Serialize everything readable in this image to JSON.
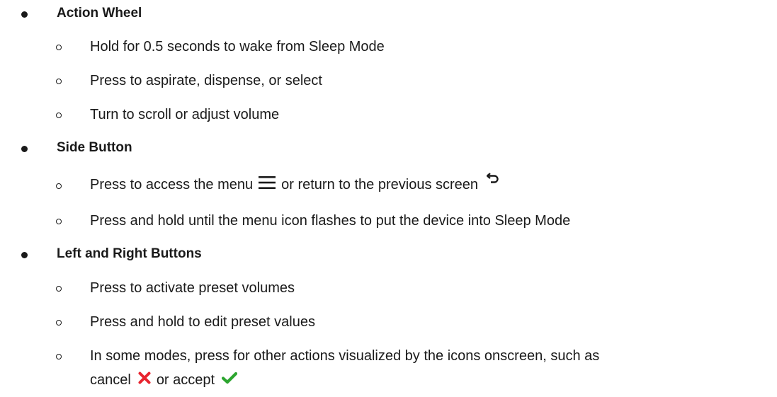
{
  "sections": [
    {
      "title": "Action Wheel",
      "items": [
        "Hold for 0.5 seconds to wake from Sleep Mode",
        "Press to aspirate, dispense, or select",
        "Turn to scroll or adjust volume"
      ]
    },
    {
      "title": "Side Button",
      "items": [
        {
          "before": "Press to access the menu",
          "icon1": "menu-icon",
          "middle": "or return to the previous screen",
          "icon2": "return-arrow-icon"
        },
        "Press and hold until the menu icon flashes to put the device into Sleep Mode"
      ]
    },
    {
      "title": "Left and Right Buttons",
      "items": [
        "Press to activate preset volumes",
        "Press and hold to edit preset values",
        {
          "line1": "In some modes, press for other actions visualized by the icons onscreen, such as",
          "line2_a": "cancel",
          "icon_cancel": "red-x-icon",
          "line2_b": "or accept",
          "icon_accept": "green-check-icon"
        }
      ]
    }
  ],
  "colors": {
    "text": "#1a1a1a",
    "cancel": "#e8232e",
    "accept": "#2ca52f"
  }
}
